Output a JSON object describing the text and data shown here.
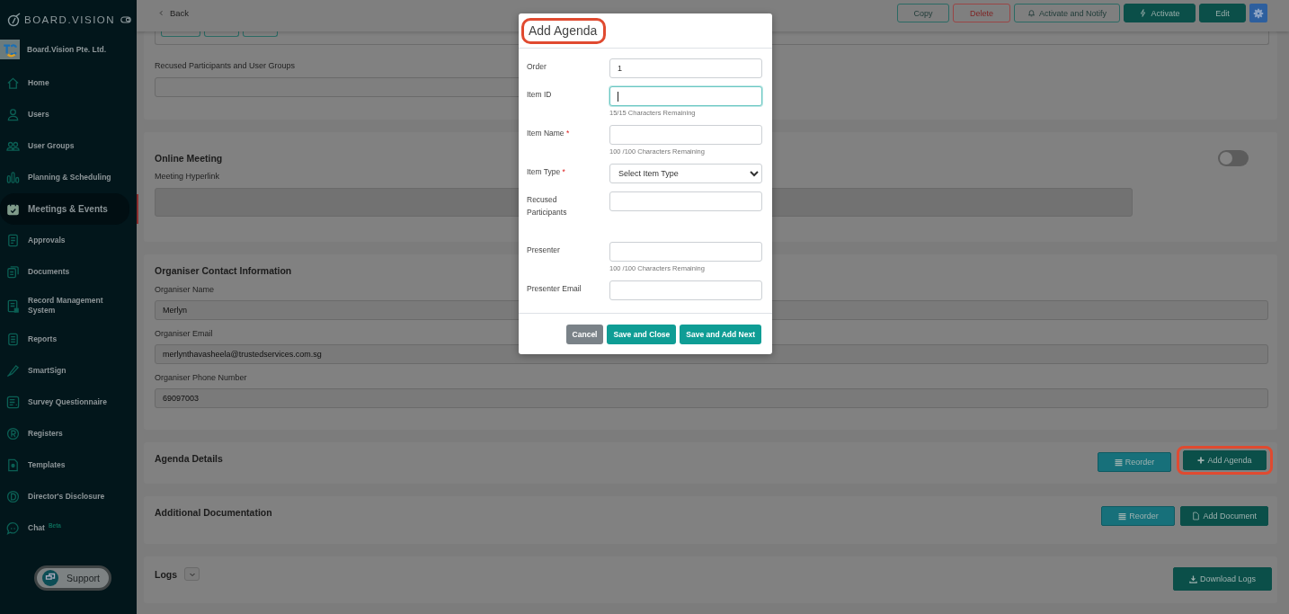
{
  "sidebar": {
    "logo": "BOARD.VISION",
    "organisation": "Board.Vision Pte. Ltd.",
    "items": [
      {
        "label": "Home",
        "selected": false
      },
      {
        "label": "Users",
        "selected": false
      },
      {
        "label": "User Groups",
        "selected": false
      },
      {
        "label": "Planning & Scheduling",
        "selected": false
      },
      {
        "label": "Meetings & Events",
        "selected": true
      },
      {
        "label": "Approvals",
        "selected": false
      },
      {
        "label": "Documents",
        "selected": false
      },
      {
        "label": "Record Management System",
        "selected": false
      },
      {
        "label": "Reports",
        "selected": false
      },
      {
        "label": "SmartSign",
        "selected": false
      },
      {
        "label": "Survey Questionnaire",
        "selected": false
      },
      {
        "label": "Registers",
        "selected": false
      },
      {
        "label": "Templates",
        "selected": false
      },
      {
        "label": "Director's Disclosure",
        "selected": false
      },
      {
        "label": "Chat",
        "selected": false,
        "badge": "Beta"
      }
    ],
    "support": "Support"
  },
  "header": {
    "back": "Back",
    "buttons": [
      {
        "label": "Copy",
        "kind": "outline"
      },
      {
        "label": "Delete",
        "kind": "danger"
      },
      {
        "label": "Activate and Notify",
        "kind": "notify"
      },
      {
        "label": "Activate",
        "kind": "activate"
      },
      {
        "label": "Edit",
        "kind": "solid"
      }
    ]
  },
  "participants": {
    "label": "Recused Participants and User Groups"
  },
  "online_meeting": {
    "title": "Online Meeting",
    "on": false,
    "field_label": "Meeting Hyperlink"
  },
  "organiser": {
    "title": "Organiser Contact Information",
    "fields": [
      {
        "label": "Organiser Name",
        "value": "Merlyn"
      },
      {
        "label": "Organiser Email",
        "value": "merlynthavasheela@trustedservices.com.sg"
      },
      {
        "label": "Organiser Phone Number",
        "value": "69097003"
      }
    ]
  },
  "agenda": {
    "title": "Agenda Details",
    "buttons": [
      {
        "label": "Reorder",
        "kind": "reorder",
        "highlighted": false
      },
      {
        "label": "Add Agenda",
        "kind": "add",
        "highlighted": true
      }
    ]
  },
  "documentation": {
    "title": "Additional Documentation",
    "buttons": [
      {
        "label": "Reorder",
        "kind": "reorder",
        "highlighted": false
      },
      {
        "label": "Add Document",
        "kind": "document",
        "highlighted": false
      }
    ]
  },
  "logs": {
    "title": "Logs",
    "expanded": false,
    "button": "Download Logs"
  },
  "dialog": {
    "title": "Add Agenda",
    "highlighted": true,
    "fields": [
      {
        "label": "Order",
        "kind": "text",
        "value": "1",
        "focused": false
      },
      {
        "label": "Item ID",
        "kind": "text",
        "focused": true,
        "hint": "15/15 Characters Remaining"
      },
      {
        "label": "Item Name",
        "kind": "text",
        "required_mark": "*",
        "focused": false,
        "hint": "100 /100 Characters Remaining"
      },
      {
        "label": "Item Type",
        "kind": "select",
        "required_mark": "*",
        "focused": false,
        "value": "Select Item Type"
      },
      {
        "label": "Recused Participants",
        "kind": "text",
        "focused": false,
        "tall_label": true
      },
      {
        "label": "Presenter",
        "kind": "text",
        "focused": false,
        "hint": "100 /100 Characters Remaining"
      },
      {
        "label": "Presenter Email",
        "kind": "text",
        "focused": false
      }
    ],
    "buttons": [
      {
        "label": "Cancel",
        "kind": "cancel"
      },
      {
        "label": "Save and Close",
        "kind": "primary"
      },
      {
        "label": "Save and Add Next",
        "kind": "primary"
      }
    ]
  }
}
